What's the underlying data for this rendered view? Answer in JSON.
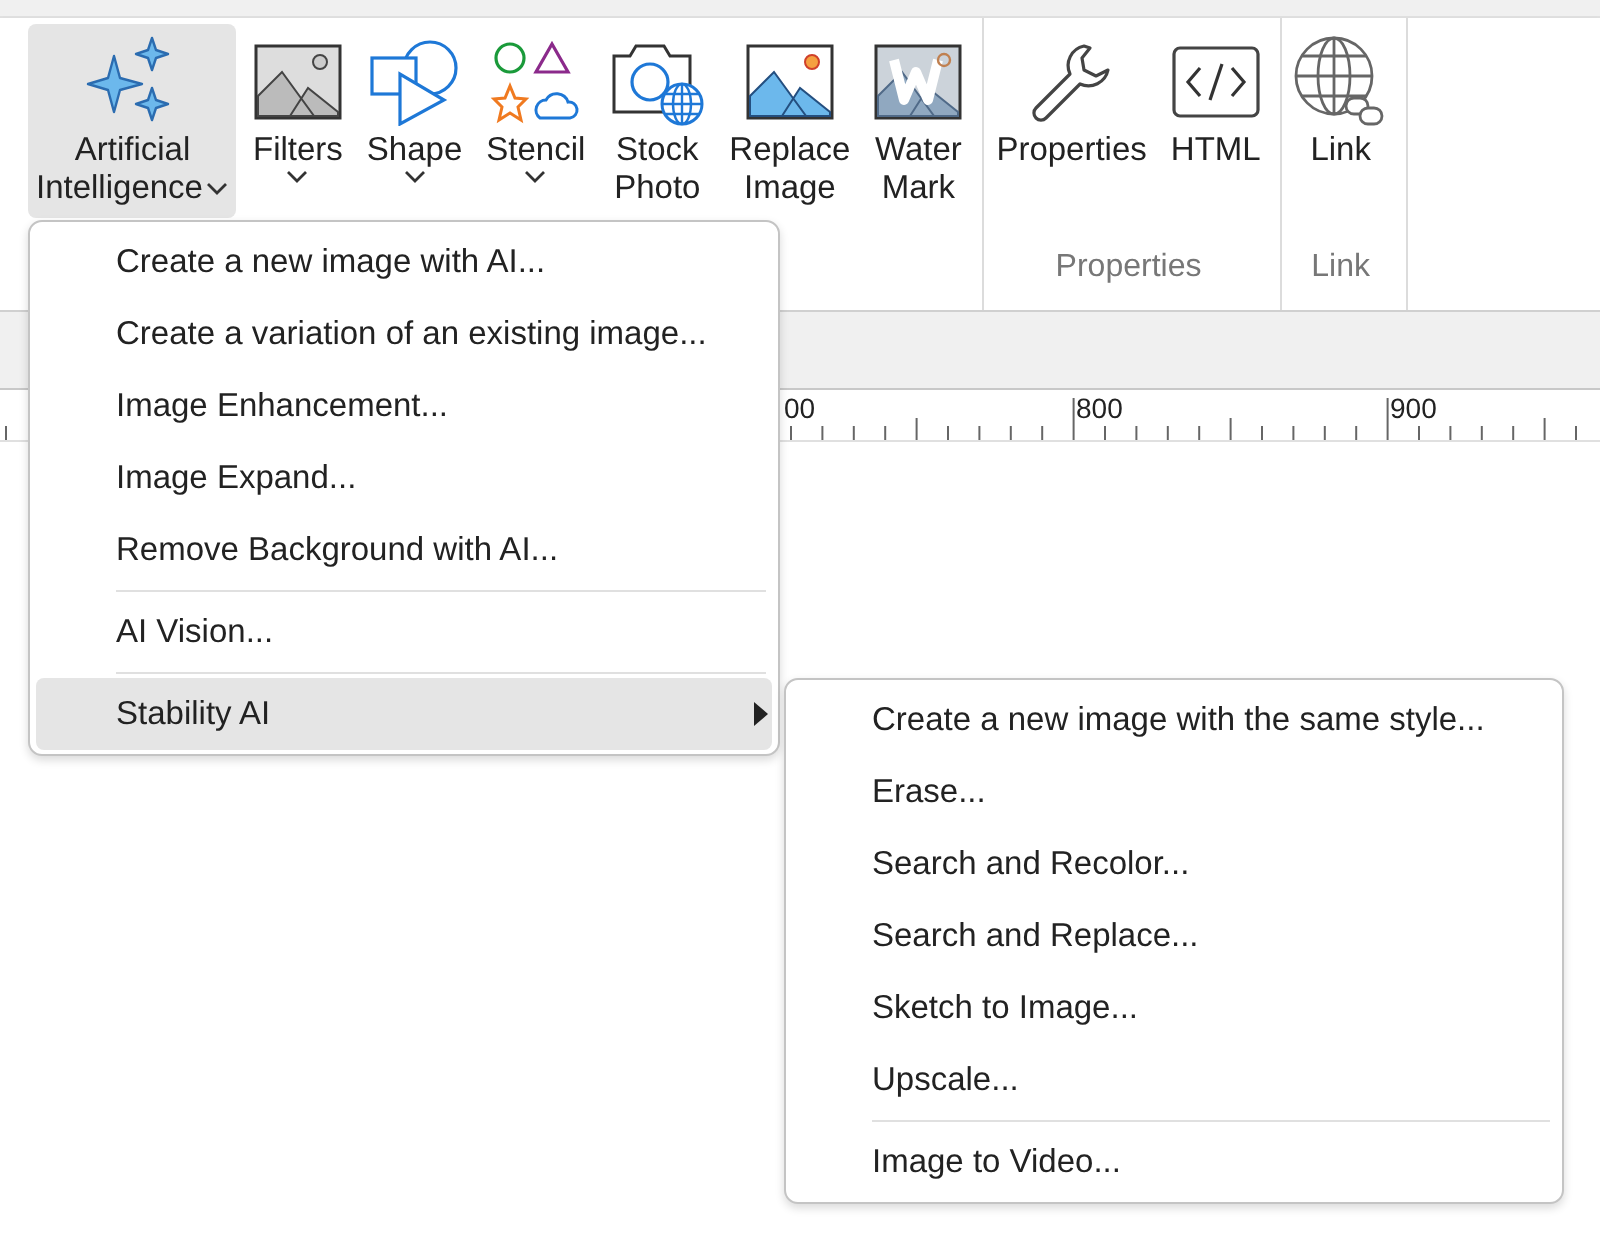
{
  "ribbon": {
    "groups": [
      {
        "buttons": [
          {
            "kind": "sparkles",
            "lines": [
              "Artificial",
              "Intelligence"
            ],
            "selected": true,
            "dropdown": true
          },
          {
            "kind": "picture",
            "lines": [
              "Filters"
            ],
            "selected": false,
            "dropdown": true
          },
          {
            "kind": "shape",
            "lines": [
              "Shape"
            ],
            "selected": false,
            "dropdown": true
          },
          {
            "kind": "stencil",
            "lines": [
              "Stencil"
            ],
            "selected": false,
            "dropdown": true
          },
          {
            "kind": "camera",
            "lines": [
              "Stock",
              "Photo"
            ],
            "selected": false
          },
          {
            "kind": "replace",
            "lines": [
              "Replace",
              "Image"
            ],
            "selected": false
          },
          {
            "kind": "watermark",
            "lines": [
              "Water",
              "Mark"
            ],
            "selected": false
          }
        ]
      },
      {
        "label": "Properties",
        "buttons": [
          {
            "kind": "wrench",
            "lines": [
              "Properties"
            ],
            "selected": false
          },
          {
            "kind": "code",
            "lines": [
              "HTML"
            ],
            "selected": false
          }
        ]
      },
      {
        "label": "Link",
        "buttons": [
          {
            "kind": "globe",
            "lines": [
              "Link"
            ],
            "selected": false
          }
        ]
      }
    ]
  },
  "ruler": {
    "labels": [
      "00",
      "800",
      "900"
    ]
  },
  "menu": {
    "items": [
      {
        "kind": "item",
        "label": "Create a new image with AI...",
        "selected": false
      },
      {
        "kind": "item",
        "label": "Create a variation of an existing image...",
        "selected": false
      },
      {
        "kind": "item",
        "label": "Image Enhancement...",
        "selected": false
      },
      {
        "kind": "item",
        "label": "Image Expand...",
        "selected": false
      },
      {
        "kind": "item",
        "label": "Remove Background with AI...",
        "selected": false
      },
      {
        "kind": "separator"
      },
      {
        "kind": "item",
        "label": "AI Vision...",
        "selected": false
      },
      {
        "kind": "separator"
      },
      {
        "kind": "submenu",
        "label": "Stability AI",
        "selected": true
      }
    ]
  },
  "submenu": {
    "items": [
      {
        "kind": "item",
        "label": "Create a new image with the same style...",
        "selected": false
      },
      {
        "kind": "item",
        "label": "Erase...",
        "selected": false
      },
      {
        "kind": "item",
        "label": "Search and Recolor...",
        "selected": false
      },
      {
        "kind": "item",
        "label": "Search and Replace...",
        "selected": false
      },
      {
        "kind": "item",
        "label": "Sketch to Image...",
        "selected": false
      },
      {
        "kind": "item",
        "label": "Upscale...",
        "selected": false
      },
      {
        "kind": "separator"
      },
      {
        "kind": "item",
        "label": "Image to Video...",
        "selected": false
      }
    ]
  }
}
